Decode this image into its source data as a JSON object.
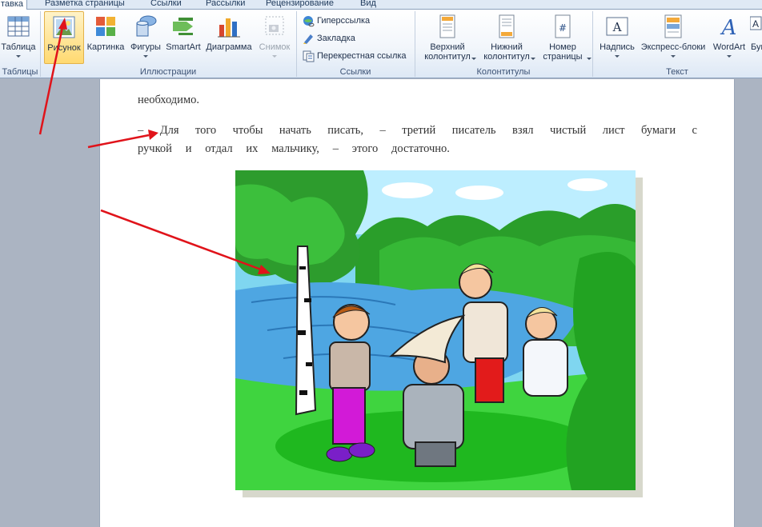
{
  "tabs": [
    {
      "label": "Вставка",
      "active": true
    },
    {
      "label": "Разметка страницы"
    },
    {
      "label": "Ссылки"
    },
    {
      "label": "Рассылки"
    },
    {
      "label": "Рецензирование"
    },
    {
      "label": "Вид"
    }
  ],
  "tab_visible_text": {
    "insert": "тавка"
  },
  "ribbon": {
    "groups": {
      "tables": "Таблицы",
      "illustrations": "Иллюстрации",
      "links": "Ссылки",
      "header_footer": "Колонтитулы",
      "text": "Текст"
    },
    "buttons": {
      "table": "Таблица",
      "picture": "Рисунок",
      "clipart": "Картинка",
      "shapes": "Фигуры",
      "smartart": "SmartArt",
      "chart": "Диаграмма",
      "screenshot": "Снимок",
      "header_line1": "Верхний",
      "header_line2": "колонтитул",
      "footer_line1": "Нижний",
      "footer_line2": "колонтитул",
      "pagenum_line1": "Номер",
      "pagenum_line2": "страницы",
      "textbox": "Надпись",
      "quickparts": "Экспресс-блоки",
      "wordart": "WordArt",
      "dropcap_partial": "Бук"
    },
    "links": {
      "hyperlink": "Гиперссылка",
      "bookmark": "Закладка",
      "crossref": "Перекрестная ссылка"
    }
  },
  "document": {
    "line1": "необходимо.",
    "line2_words": [
      "–",
      "Для",
      "того",
      "чтобы",
      "начать",
      "писать,",
      "–",
      "третий",
      "писатель",
      "взял",
      "чистый",
      "лист",
      "бумаги",
      "с"
    ],
    "line3_words": [
      "ручкой",
      "и",
      "отдал",
      "их",
      "мальчику,",
      "–",
      "этого",
      "достаточно."
    ]
  },
  "colors": {
    "annotation_arrow": "#e0131a",
    "ribbon_accent": "#1e395b"
  }
}
